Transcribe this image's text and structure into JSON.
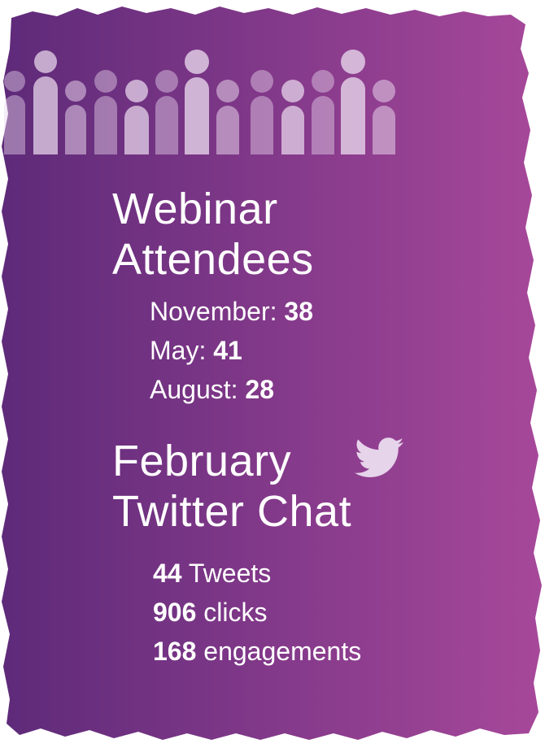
{
  "colors": {
    "gradient_start": "#5e2a79",
    "gradient_end": "#a7489a",
    "figure_tint": "#e6d4ea",
    "text": "#ffffff"
  },
  "webinar": {
    "title_line1": "Webinar",
    "title_line2": "Attendees",
    "stats": [
      {
        "label": "November: ",
        "value": "38"
      },
      {
        "label": "May: ",
        "value": "41"
      },
      {
        "label": "August: ",
        "value": "28"
      }
    ]
  },
  "twitter": {
    "title_line1": "February",
    "title_line2": "Twitter Chat",
    "icon": "twitter-bird-icon",
    "stats": [
      {
        "value": "44",
        "label": " Tweets"
      },
      {
        "value": "906",
        "label": " clicks"
      },
      {
        "value": "168",
        "label": " engagements"
      }
    ]
  },
  "decoration": {
    "icon": "people-row-icon"
  }
}
